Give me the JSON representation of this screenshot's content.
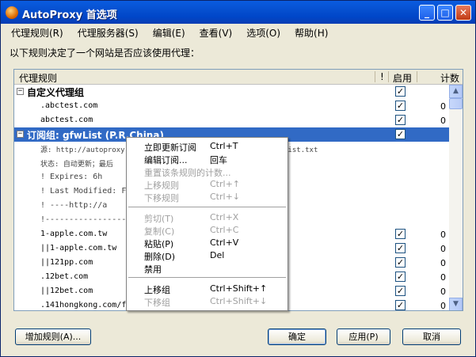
{
  "window": {
    "title": "AutoProxy 首选项",
    "min_glyph": "_",
    "max_glyph": "□",
    "close_glyph": "✕"
  },
  "menu": [
    "代理规则(R)",
    "代理服务器(S)",
    "编辑(E)",
    "查看(V)",
    "选项(O)",
    "帮助(H)"
  ],
  "description": "以下规则决定了一个网站是否应该使用代理：",
  "columns": {
    "rule": "代理规则",
    "bang": "!",
    "enabled": "启用",
    "count": "计数"
  },
  "rows": [
    {
      "text": "自定义代理组",
      "expander": "−",
      "checked": true,
      "count": ""
    },
    {
      "text": ".abctest.com",
      "checked": true,
      "count": "0"
    },
    {
      "text": "abctest.com",
      "checked": true,
      "count": "0"
    },
    {
      "text": "订阅组: gfwList (P.R.China)",
      "expander": "−",
      "checked": true,
      "count": ""
    },
    {
      "text": "源:  http://autoproxy-gfwlist.googlecode.com/svn/trunk/gfwlist.txt",
      "checked": false,
      "count": ""
    },
    {
      "text": "状态:  自动更新；最后",
      "checked": false,
      "count": ""
    },
    {
      "text": "! Expires: 6h",
      "checked": false,
      "count": ""
    },
    {
      "text": "! Last Modified: F",
      "checked": false,
      "count": ""
    },
    {
      "text": "!     ----http://a",
      "checked": false,
      "count": ""
    },
    {
      "text": "!------------------",
      "checked": false,
      "count": ""
    },
    {
      "text": "1-apple.com.tw",
      "checked": true,
      "count": "0"
    },
    {
      "text": "||1-apple.com.tw",
      "checked": true,
      "count": "0"
    },
    {
      "text": "||121pp.com",
      "checked": true,
      "count": "0"
    },
    {
      "text": ".12bet.com",
      "checked": true,
      "count": "0"
    },
    {
      "text": "||12bet.com",
      "checked": true,
      "count": "0"
    },
    {
      "text": ".141hongkong.com/f",
      "checked": true,
      "count": "0"
    }
  ],
  "context_menu": [
    {
      "label": "立即更新订阅",
      "shortcut": "Ctrl+T",
      "disabled": false
    },
    {
      "label": "编辑订阅...",
      "shortcut": "回车",
      "disabled": false
    },
    {
      "label": "重置该条规则的计数...",
      "shortcut": "",
      "disabled": true
    },
    {
      "label": "上移规则",
      "shortcut": "Ctrl+↑",
      "disabled": true
    },
    {
      "label": "下移规则",
      "shortcut": "Ctrl+↓",
      "disabled": true
    },
    {
      "label": "剪切(T)",
      "shortcut": "Ctrl+X",
      "disabled": true
    },
    {
      "label": "复制(C)",
      "shortcut": "Ctrl+C",
      "disabled": true
    },
    {
      "label": "粘贴(P)",
      "shortcut": "Ctrl+V",
      "disabled": false
    },
    {
      "label": "删除(D)",
      "shortcut": "Del",
      "disabled": false
    },
    {
      "label": "禁用",
      "shortcut": "",
      "disabled": false
    },
    {
      "label": "上移组",
      "shortcut": "Ctrl+Shift+↑",
      "disabled": false
    },
    {
      "label": "下移组",
      "shortcut": "Ctrl+Shift+↓",
      "disabled": true
    }
  ],
  "buttons": {
    "add_rule": "增加规则(A)...",
    "ok": "确定",
    "apply": "应用(P)",
    "cancel": "取消"
  },
  "scroll_up_glyph": "▲",
  "scroll_down_glyph": "▼"
}
